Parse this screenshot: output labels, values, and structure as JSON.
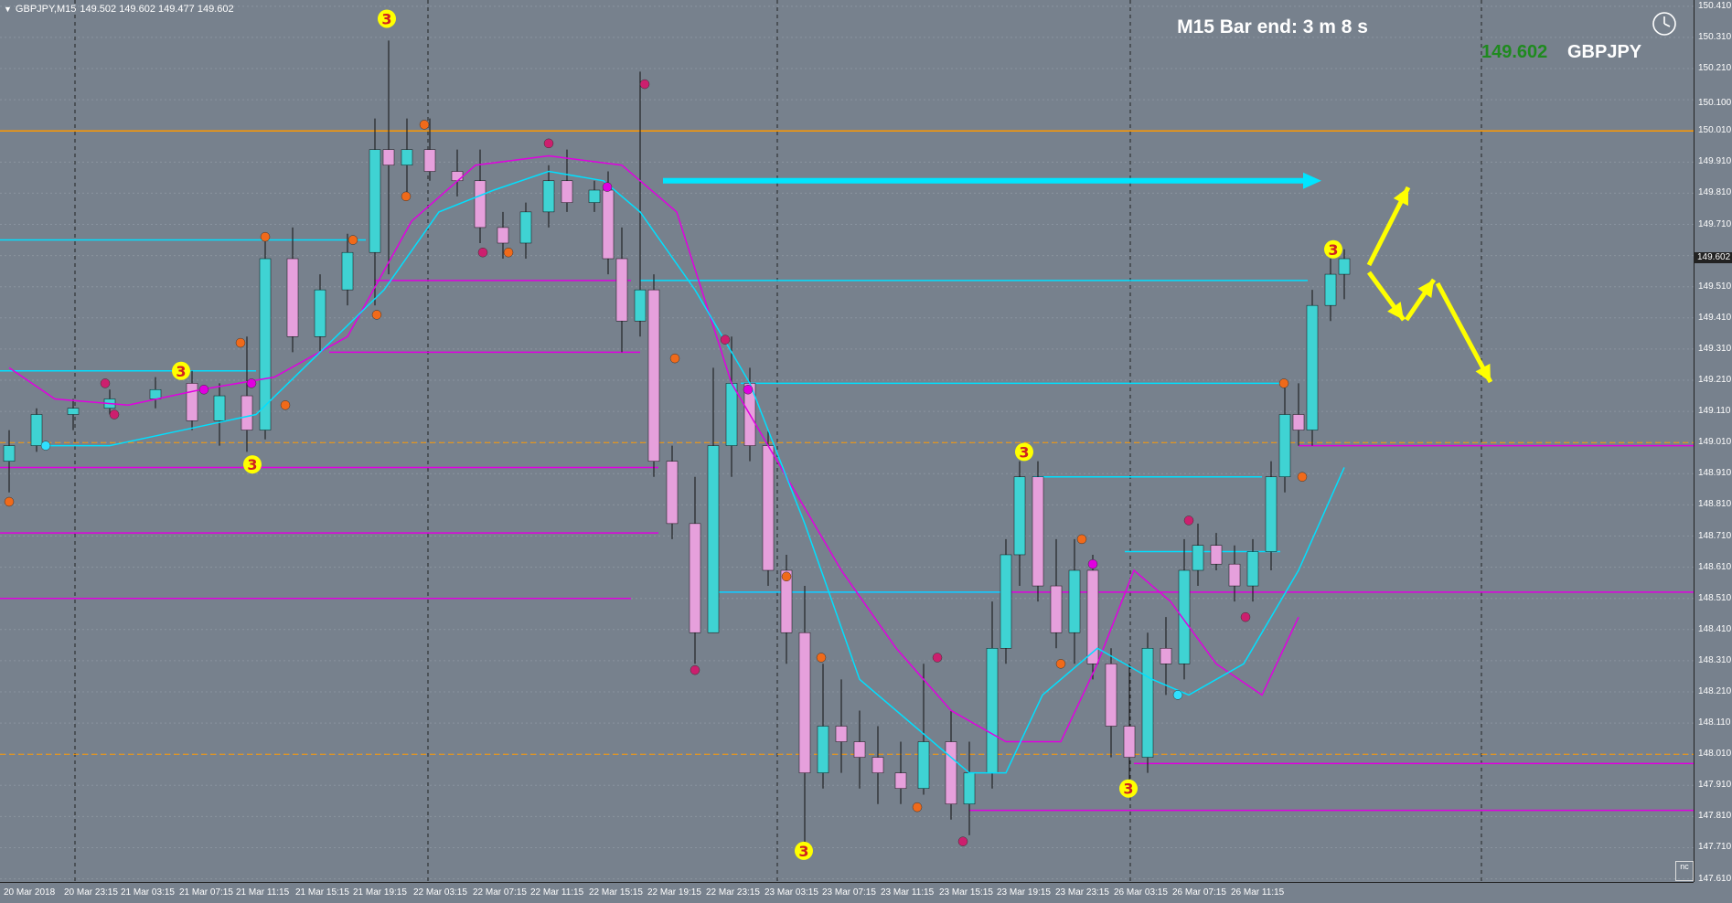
{
  "window": {
    "symbol_info": "GBPJPY,M15",
    "ohlc": "149.502 149.602 149.477 149.602"
  },
  "overlay": {
    "bar_timer": "M15 Bar end: 3 m 8 s",
    "price": "149.602",
    "symbol": "GBPJPY",
    "price_color": "#1f8a1f"
  },
  "price_axis": {
    "labels": [
      "150.410",
      "150.310",
      "150.210",
      "150.100",
      "150.010",
      "149.910",
      "149.810",
      "149.710",
      "149.602",
      "149.510",
      "149.410",
      "149.310",
      "149.210",
      "149.110",
      "149.010",
      "148.910",
      "148.810",
      "148.710",
      "148.610",
      "148.510",
      "148.410",
      "148.310",
      "148.210",
      "148.110",
      "148.010",
      "147.910",
      "147.810",
      "147.710",
      "147.610"
    ],
    "current_price": "149.602"
  },
  "time_axis": {
    "labels": [
      "20 Mar 2018",
      "20 Mar 23:15",
      "21 Mar 03:15",
      "21 Mar 07:15",
      "21 Mar 11:15",
      "21 Mar 15:15",
      "21 Mar 19:15",
      "22 Mar 03:15",
      "22 Mar 07:15",
      "22 Mar 11:15",
      "22 Mar 15:15",
      "22 Mar 19:15",
      "22 Mar 23:15",
      "23 Mar 03:15",
      "23 Mar 07:15",
      "23 Mar 11:15",
      "23 Mar 15:15",
      "23 Mar 19:15",
      "23 Mar 23:15",
      "26 Mar 03:15",
      "26 Mar 07:15",
      "26 Mar 11:15"
    ]
  },
  "markers": {
    "swing_label": "3"
  },
  "icons": {
    "clock": "clock-icon",
    "menu": "triangle-down-icon"
  },
  "colors": {
    "background": "#77818d",
    "bull_candle": "#3fd3d3",
    "bear_candle": "#e6a0dc",
    "resistance_line": "#ff9900",
    "magenta_line": "#e000e0",
    "cyan_line": "#00e0ff",
    "arrow_yellow": "#ffff00",
    "arrow_cyan": "#00e5ff"
  },
  "corner_badge": "nc"
}
